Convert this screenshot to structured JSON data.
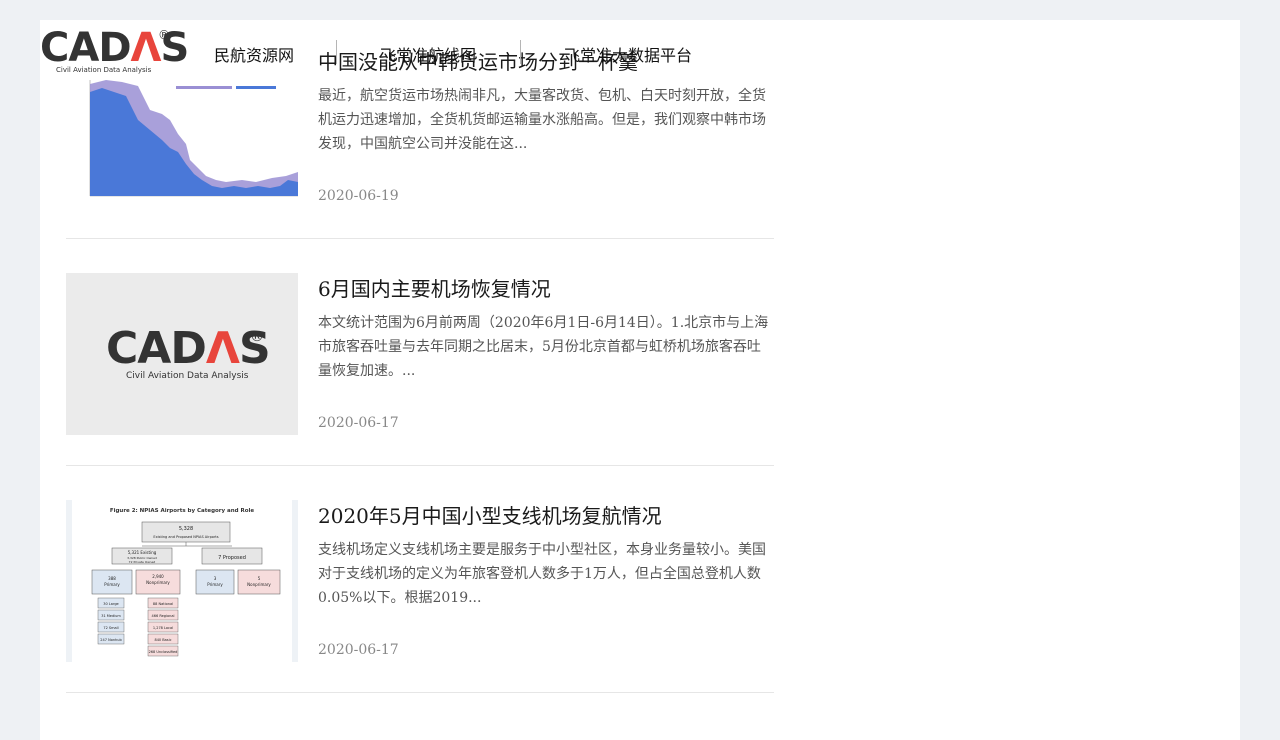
{
  "header": {
    "logo_text": "CADAS",
    "logo_reg": "®",
    "logo_sub": "Civil Aviation Data Analysis",
    "nav": [
      "民航资源网",
      "飞常准航线图",
      "飞常准大数据平台"
    ]
  },
  "articles": [
    {
      "title": "中国没能从中韩货运市场分到一杯羹",
      "excerpt": "最近，航空货运市场热闹非凡，大量客改货、包机、白天时刻开放，全货机运力迅速增加，全货机货邮运输量水涨船高。但是，我们观察中韩市场发现，中国航空公司并没能在这...",
      "date": "2020-06-19",
      "thumb": "area-chart"
    },
    {
      "title": "6月国内主要机场恢复情况",
      "excerpt": "本文统计范围为6月前两周（2020年6月1日-6月14日）。1.北京市与上海市旅客吞吐量与去年同期之比居末，5月份北京首都与虹桥机场旅客吞吐量恢复加速。...",
      "date": "2020-06-17",
      "thumb": "cadas-logo"
    },
    {
      "title": "2020年5月中国小型支线机场复航情况",
      "excerpt": "支线机场定义支线机场主要是服务于中小型社区，本身业务量较小。美国对于支线机场的定义为年旅客登机人数多于1万人，但占全国总登机人数0.05%以下。根据2019...",
      "date": "2020-06-17",
      "thumb": "npias-diagram"
    }
  ],
  "thumb2": {
    "logo_text": "CADAS",
    "logo_reg": "®",
    "logo_sub": "Civil Aviation Data Analysis"
  },
  "thumb3": {
    "figure_title": "Figure 2: NPIAS Airports by Category and Role",
    "root_num": "5,328",
    "root_label": "Existing and Proposed NPIAS Airports",
    "existing_num": "5,321 Existing",
    "existing_sub1": "3,328 Public Owned",
    "existing_sub2": "72 Private Owned",
    "proposed_label": "7 Proposed",
    "primary_num": "388",
    "primary_label": "Primary",
    "nonprimary_num": "2,940",
    "nonprimary_label": "Nonprimary",
    "p_primary_num": "3",
    "p_primary_label": "Primary",
    "p_nonprimary_num": "5",
    "p_nonprimary_label": "Nonprimary",
    "large": "30 Large",
    "medium": "31 Medium",
    "small": "72 Small",
    "nonhub": "247 Nonhub",
    "national": "88 National",
    "regional": "466 Regional",
    "local": "1,278 Local",
    "basic": "840 Basic",
    "unclassified": "268 Unclassified"
  },
  "colors": {
    "background": "#eef1f4",
    "panel": "#ffffff",
    "accent_red": "#e8453c",
    "chart_blue": "#4a78d8",
    "chart_purple": "#9a8fd4"
  }
}
